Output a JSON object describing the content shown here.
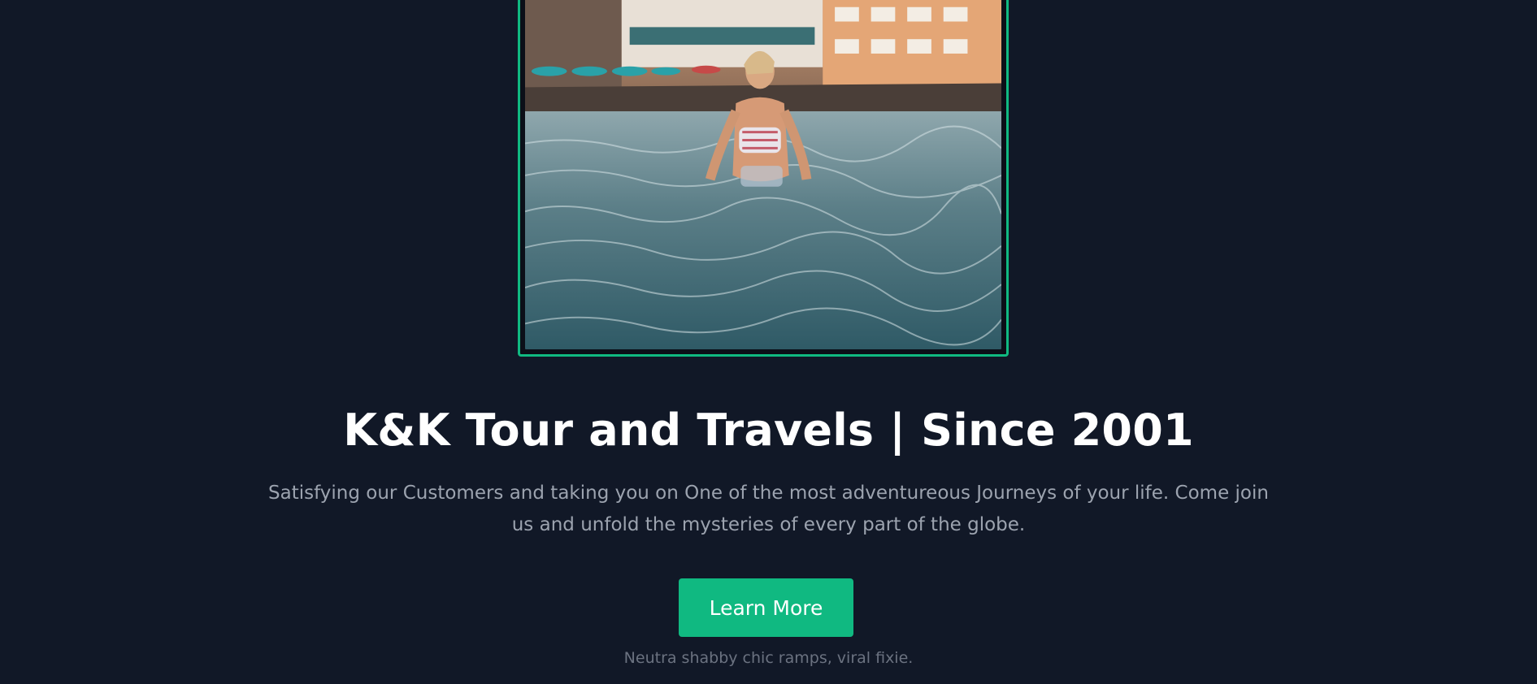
{
  "hero": {
    "image_alt": "Woman standing in sea water in front of a coastal town",
    "headline": "K&K Tour and Travels | Since 2001",
    "description": "Satisfying our Customers and taking you on One of the most adventureous Journeys of your life. Come join us and unfold the mysteries of every part of the globe.",
    "button_label": "Learn More",
    "tagline": "Neutra shabby chic ramps, viral fixie."
  },
  "colors": {
    "background": "#111827",
    "accent": "#10b981",
    "headline": "#ffffff",
    "body_text": "#9ca3af",
    "muted_text": "#6b7280"
  }
}
